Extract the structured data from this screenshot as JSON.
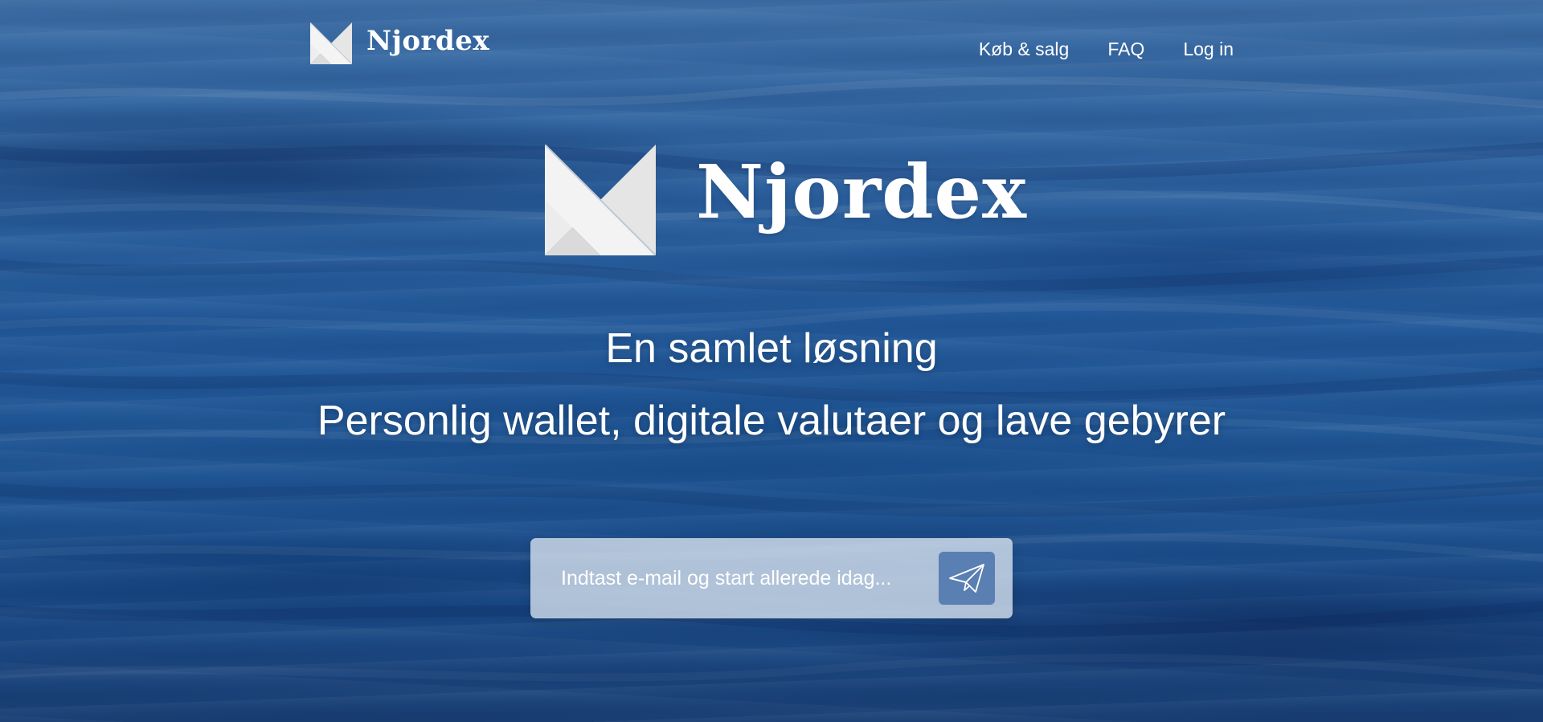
{
  "brand": {
    "name": "Njordex"
  },
  "nav": {
    "items": [
      {
        "label": "Køb & salg"
      },
      {
        "label": "FAQ"
      },
      {
        "label": "Log in"
      }
    ]
  },
  "hero": {
    "title": "Njordex",
    "tagline": "En samlet løsning",
    "subtitle": "Personlig wallet, digitale valutaer og lave gebyrer"
  },
  "signup": {
    "email_placeholder": "Indtast e-mail og start allerede idag...",
    "email_value": "",
    "submit_icon": "paper-plane-icon"
  },
  "colors": {
    "text": "#ffffff",
    "submit_button": "#5a7fb2",
    "water_top": "#3d6ea6",
    "water_bottom": "#1a3f75",
    "logo_fill": "#eeeeee"
  }
}
